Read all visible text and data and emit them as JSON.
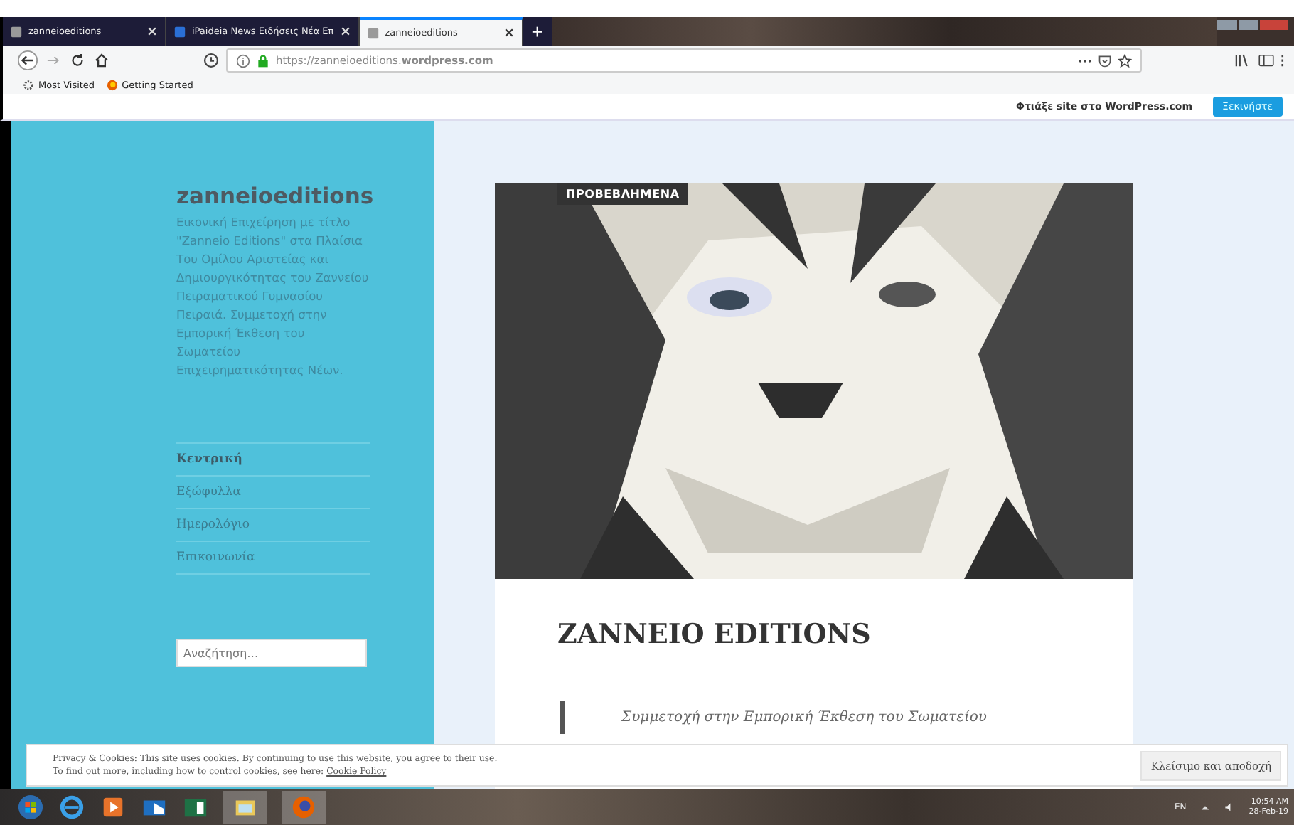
{
  "browser": {
    "tabs": [
      {
        "title": "zanneioeditions",
        "selected": false
      },
      {
        "title": "iPaideia News Ειδήσεις Νέα Επ",
        "selected": false
      },
      {
        "title": "zanneioeditions",
        "selected": true
      }
    ],
    "new_tab": "+",
    "url": "https://zanneioeditions.**wordpress.com**",
    "bookmarks": [
      "Most Visited",
      "Getting Started"
    ]
  },
  "wp_bar": {
    "text": "Φτιάξε site στο WordPress.com",
    "button": "Ξεκινήστε"
  },
  "sidebar": {
    "title": "zanneioeditions",
    "description": "Εικονική Επιχείρηση με τίτλο \"Zanneio Editions\" στα Πλαίσια Του Ομίλου Αριστείας και Δημιουργικότητας του Ζαννείου Πειραματικού Γυμνασίου Πειραιά. Συμμετοχή στην Εμπορική Έκθεση του Σωματείου Επιχειρηματικότητας Νέων.",
    "menu": [
      {
        "label": "Κεντρική",
        "selected": true
      },
      {
        "label": "Εξώφυλλα",
        "selected": false
      },
      {
        "label": "Ημερολόγιο",
        "selected": false
      },
      {
        "label": "Επικοινωνία",
        "selected": false
      }
    ],
    "search": {
      "placeholder": "Αναζήτηση…"
    }
  },
  "post": {
    "badge": "ΠΡΟΒΕΒΛΗΜΕΝΑ",
    "title": "ZANNEIO EDITIONS",
    "quote": "Συμμετοχή στην Εμπορική Έκθεση του Σωματείου"
  },
  "cookie_bar": {
    "line_1": "Privacy & Cookies: This site uses cookies. By continuing to use this website, you agree to their use.",
    "line_2": "To find out more, including how to control cookies, see here:",
    "link": "Cookie Policy",
    "button": "Κλείσιμο και αποδοχή"
  },
  "taskbar": {
    "language": "EN",
    "time": "10:54 AM",
    "date": "28-Feb-19"
  }
}
